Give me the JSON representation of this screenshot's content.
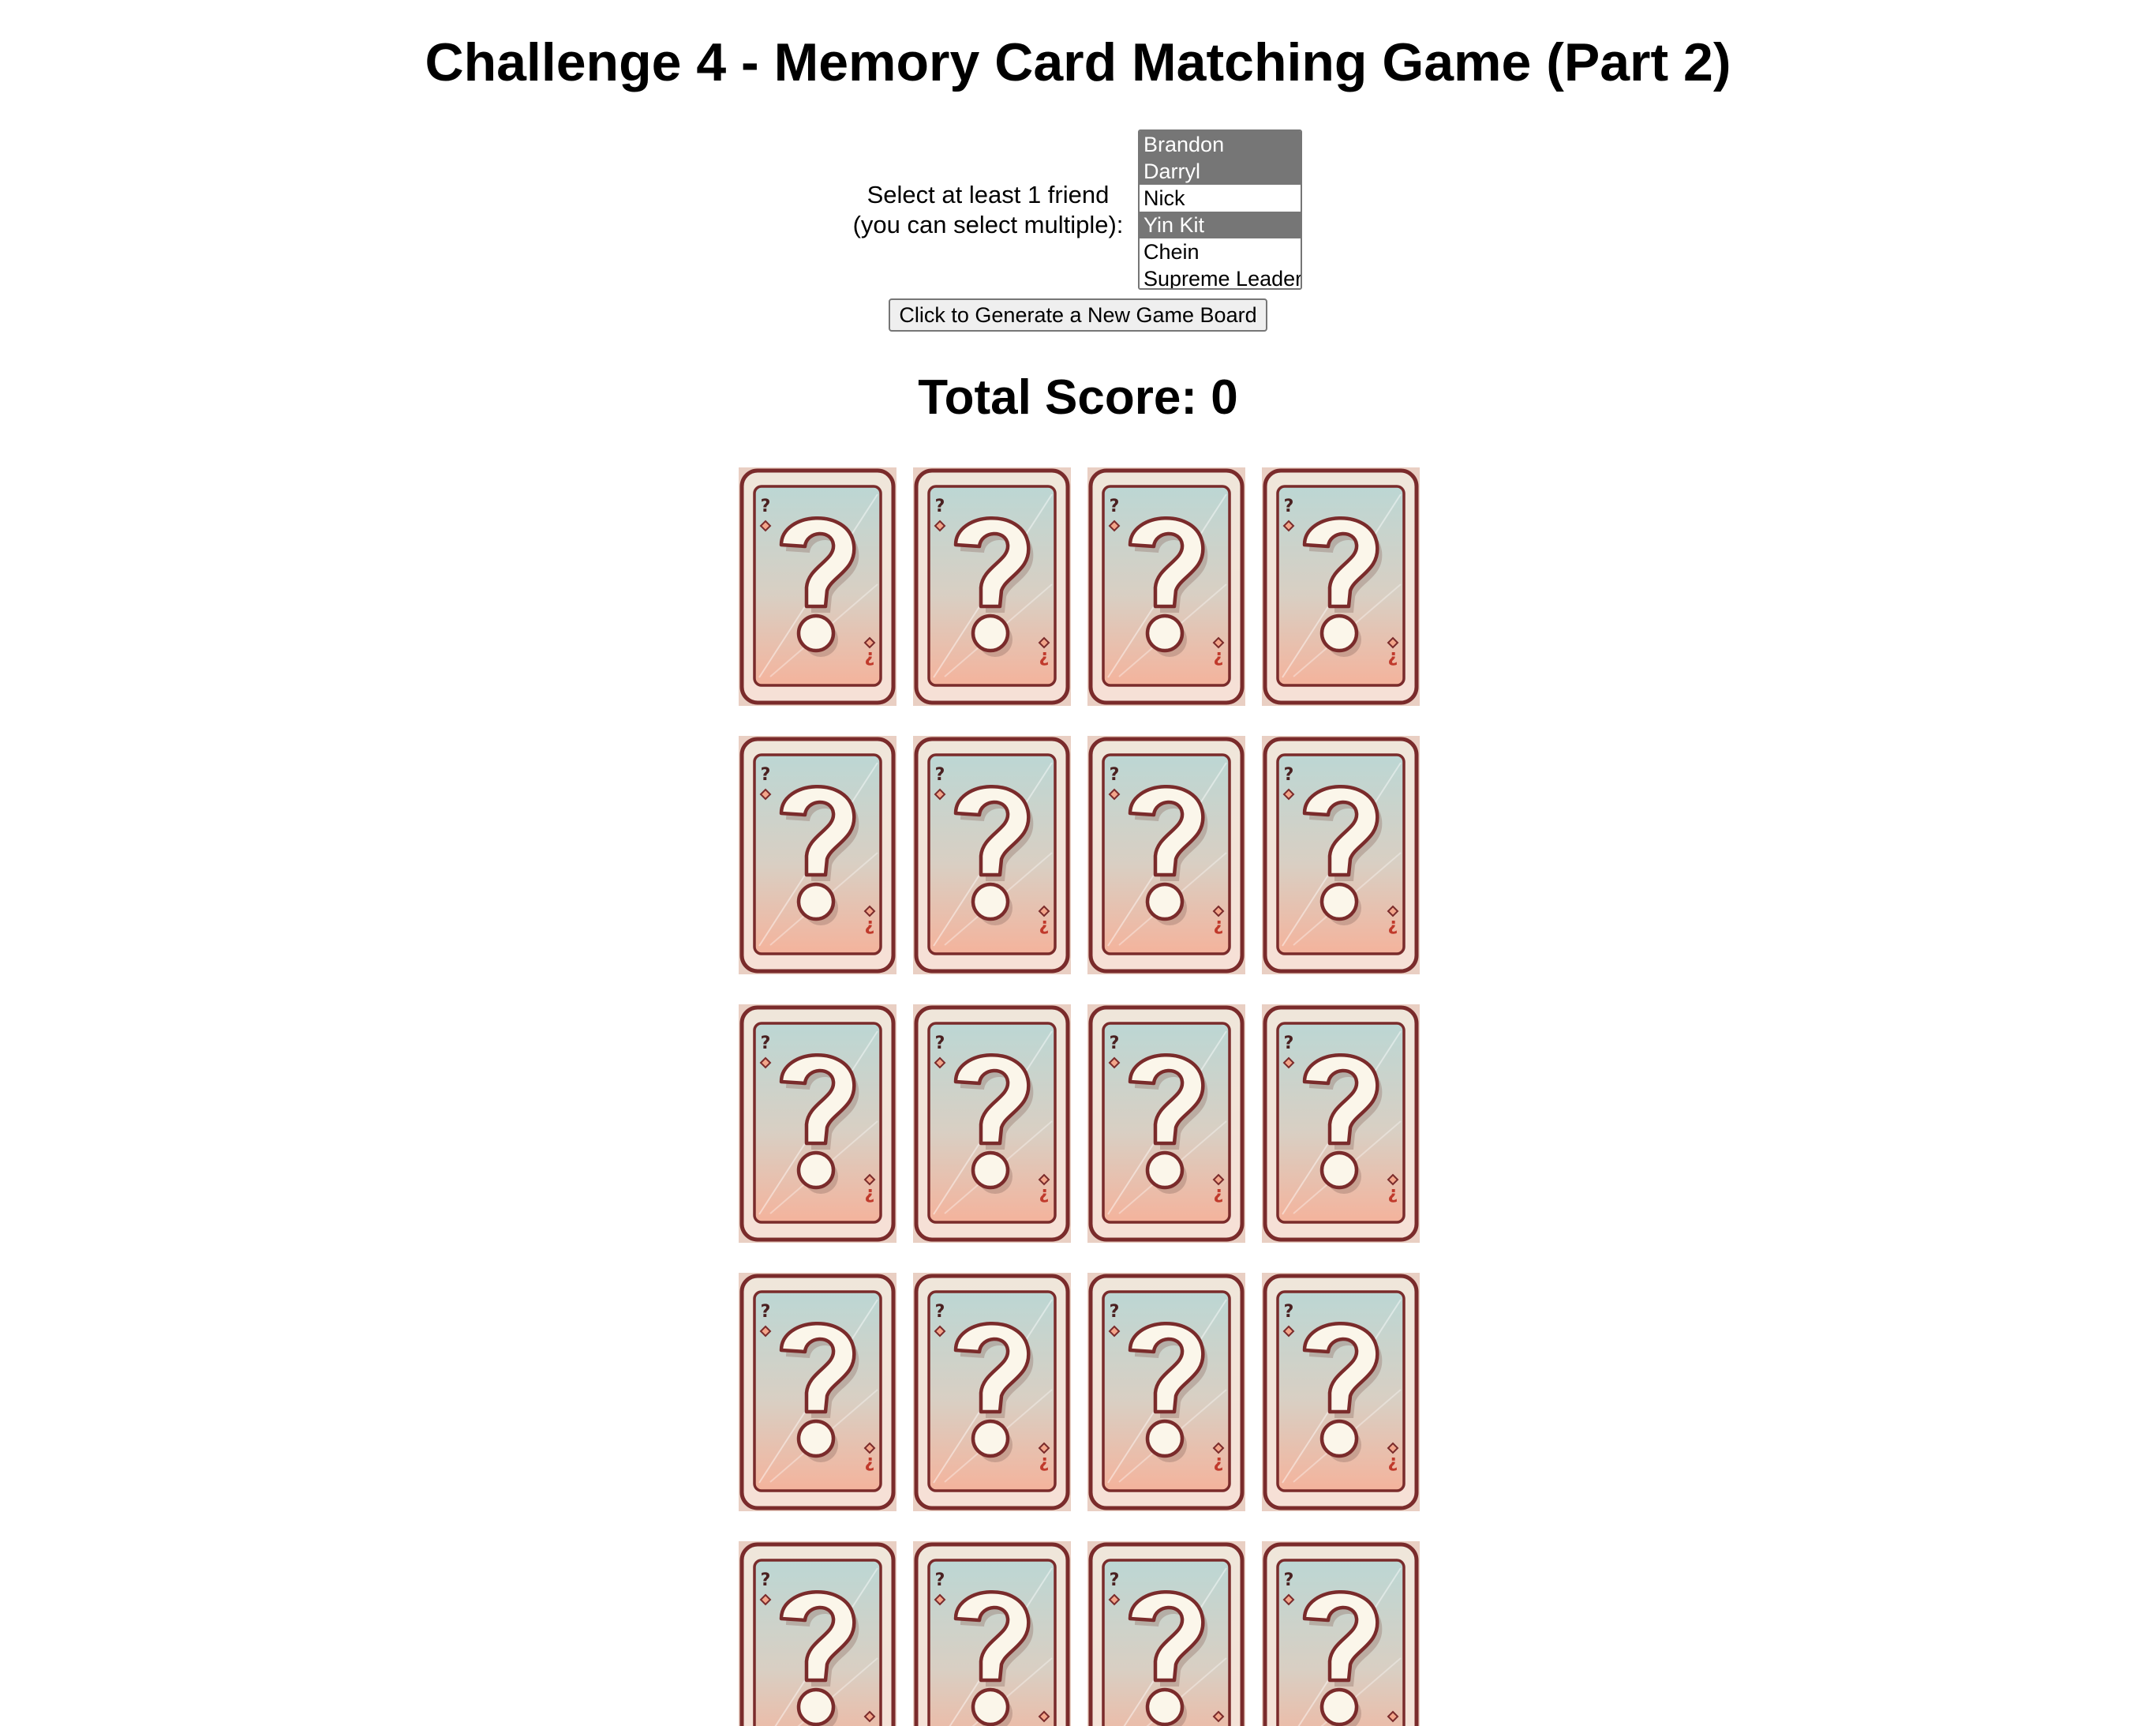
{
  "page": {
    "title": "Challenge 4 - Memory Card Matching Game (Part 2)"
  },
  "friend_select": {
    "label_line1": "Select at least 1 friend",
    "label_line2": "(you can select multiple):",
    "options": [
      {
        "label": "Brandon",
        "selected": true
      },
      {
        "label": "Darryl",
        "selected": true
      },
      {
        "label": "Nick",
        "selected": false
      },
      {
        "label": "Yin Kit",
        "selected": true
      },
      {
        "label": "Chein",
        "selected": false
      },
      {
        "label": "Supreme Leader",
        "selected": false
      }
    ]
  },
  "generate_button": {
    "label": "Click to Generate a New Game Board"
  },
  "score": {
    "text": "Total Score: 0",
    "value": 0
  },
  "board": {
    "columns": 4,
    "visible_rows": 5,
    "card_state": "face-down",
    "card_icon": "question-mark-card-back-icon"
  },
  "colors": {
    "selected_option_bg": "#767676",
    "card_border": "#7a2b2b",
    "card_face_top": "#bfd8d5",
    "card_face_bottom": "#f3b7a0",
    "question_mark_fill": "#fbf6ea"
  }
}
